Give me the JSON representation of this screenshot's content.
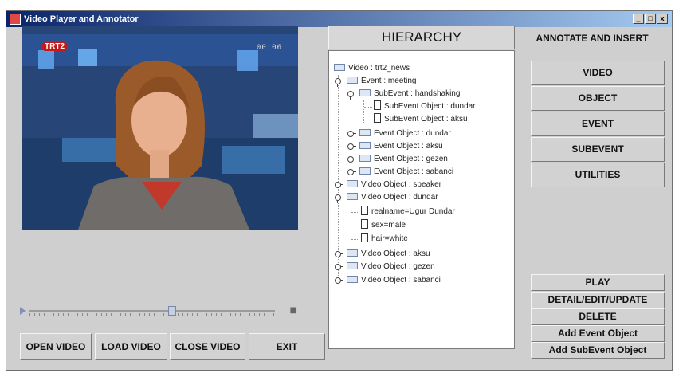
{
  "window": {
    "title": "Video Player and Annotator",
    "controls": [
      "_",
      "□",
      "x"
    ]
  },
  "video": {
    "channel_logo": "TRT2",
    "timecode": "00:06",
    "progress": 0.58
  },
  "player_buttons": {
    "open": "OPEN VIDEO",
    "load": "LOAD VIDEO",
    "close": "CLOSE VIDEO",
    "exit": "EXIT"
  },
  "hierarchy": {
    "header": "HIERARCHY",
    "nodes": [
      "Video : trt2_news",
      "Event : meeting",
      "SubEvent : handshaking",
      "SubEvent Object : dundar",
      "SubEvent Object : aksu",
      "Event Object : dundar",
      "Event Object : aksu",
      "Event Object : gezen",
      "Event Object : sabanci",
      "Video Object : speaker",
      "Video Object : dundar",
      "realname=Ugur Dundar",
      "sex=male",
      "hair=white",
      "Video Object : aksu",
      "Video Object : gezen",
      "Video Object : sabanci"
    ]
  },
  "annotate": {
    "title": "ANNOTATE AND INSERT",
    "buttons": [
      "VIDEO",
      "OBJECT",
      "EVENT",
      "SUBEVENT",
      "UTILITIES"
    ]
  },
  "actions": [
    "PLAY",
    "DETAIL/EDIT/UPDATE",
    "DELETE",
    "Add Event Object",
    "Add SubEvent Object"
  ]
}
